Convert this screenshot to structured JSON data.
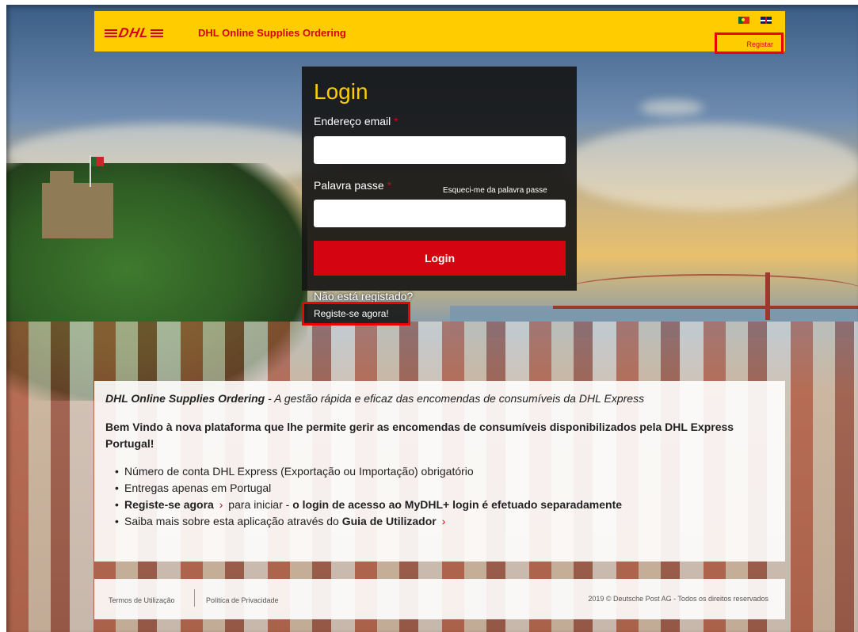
{
  "header": {
    "logo_text": "DHL",
    "app_title": "DHL Online Supplies Ordering",
    "lang_flags": [
      "portugal-flag-icon",
      "uk-flag-icon"
    ],
    "register_link": "Registar"
  },
  "login": {
    "title": "Login",
    "email_label": "Endereço email",
    "password_label": "Palavra passe",
    "required_mark": "*",
    "forgot_link": "Esqueci-me da palavra passe",
    "email_value": "",
    "password_value": "",
    "button_label": "Login",
    "not_registered": "Não está registado?",
    "register_now": "Registe-se agora!"
  },
  "info": {
    "tagline_bold": "DHL Online Supplies Ordering",
    "tagline_rest": " - A gestão rápida e eficaz das encomendas de consumíveis da DHL Express",
    "welcome": "Bem Vindo à nova plataforma que lhe permite gerir as encomendas de consumíveis disponibilizados pela DHL Express Portugal!",
    "bullets": {
      "b1": "Número de conta DHL Express (Exportação ou Importação) obrigatório",
      "b2": "Entregas apenas em Portugal",
      "b3_link": "Registe-se agora",
      "b3_mid": " para iniciar - ",
      "b3_bold": "o login de acesso ao MyDHL+ login é efetuado separadamente",
      "b4_pre": "Saiba mais sobre esta aplicação através do ",
      "b4_link": "Guia de Utilizador"
    },
    "chevron": "›"
  },
  "footer": {
    "terms": "Termos de Utilização",
    "privacy": "Política de Privacidade",
    "copyright": "2019 © Deutsche Post AG - Todos os direitos reservados"
  },
  "colors": {
    "brand_yellow": "#ffcc00",
    "brand_red": "#d40511",
    "highlight_red": "#ee0000"
  }
}
